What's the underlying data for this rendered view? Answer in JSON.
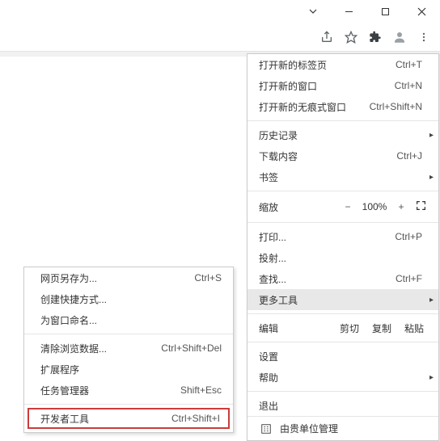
{
  "menu": {
    "new_tab": "打开新的标签页",
    "new_tab_sc": "Ctrl+T",
    "new_window": "打开新的窗口",
    "new_window_sc": "Ctrl+N",
    "incognito": "打开新的无痕式窗口",
    "incognito_sc": "Ctrl+Shift+N",
    "history": "历史记录",
    "downloads": "下载内容",
    "downloads_sc": "Ctrl+J",
    "bookmarks": "书签",
    "zoom": "缩放",
    "zoom_minus": "−",
    "zoom_val": "100%",
    "zoom_plus": "+",
    "print": "打印...",
    "print_sc": "Ctrl+P",
    "cast": "投射...",
    "find": "查找...",
    "find_sc": "Ctrl+F",
    "more_tools": "更多工具",
    "edit": "编辑",
    "cut": "剪切",
    "copy": "复制",
    "paste": "粘贴",
    "settings": "设置",
    "help": "帮助",
    "exit": "退出",
    "managed": "由贵单位管理"
  },
  "submenu": {
    "save_as": "网页另存为...",
    "save_as_sc": "Ctrl+S",
    "shortcut": "创建快捷方式...",
    "name_window": "为窗口命名...",
    "clear_data": "清除浏览数据...",
    "clear_data_sc": "Ctrl+Shift+Del",
    "extensions": "扩展程序",
    "task_mgr": "任务管理器",
    "task_mgr_sc": "Shift+Esc",
    "dev_tools": "开发者工具",
    "dev_tools_sc": "Ctrl+Shift+I"
  }
}
